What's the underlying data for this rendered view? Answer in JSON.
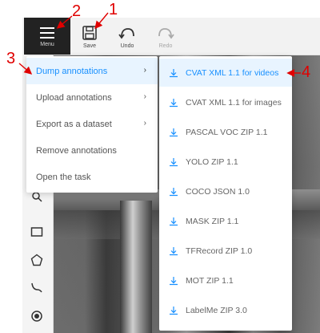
{
  "toolbar": {
    "menu_label": "Menu",
    "save_label": "Save",
    "undo_label": "Undo",
    "redo_label": "Redo"
  },
  "main_menu": {
    "items": [
      {
        "label": "Dump annotations",
        "has_submenu": true,
        "active": true
      },
      {
        "label": "Upload annotations",
        "has_submenu": true
      },
      {
        "label": "Export as a dataset",
        "has_submenu": true
      },
      {
        "label": "Remove annotations",
        "has_submenu": false
      },
      {
        "label": "Open the task",
        "has_submenu": false
      }
    ],
    "submenu_arrow": "›"
  },
  "dump_submenu": {
    "items": [
      {
        "label": "CVAT XML 1.1 for videos",
        "active": true
      },
      {
        "label": "CVAT XML 1.1 for images"
      },
      {
        "label": "PASCAL VOC ZIP 1.1"
      },
      {
        "label": "YOLO ZIP 1.1"
      },
      {
        "label": "COCO JSON 1.0"
      },
      {
        "label": "MASK ZIP 1.1"
      },
      {
        "label": "TFRecord ZIP 1.0"
      },
      {
        "label": "MOT ZIP 1.1"
      },
      {
        "label": "LabelMe ZIP 3.0"
      }
    ],
    "icon": "download-icon"
  },
  "annotations": {
    "n1": "1",
    "n2": "2",
    "n3": "3",
    "n4": "4"
  },
  "colors": {
    "accent": "#1890ff",
    "annotation": "#e00000",
    "menu_button_bg": "#222222"
  },
  "sidebar_icons": [
    "search-icon",
    "rectangle-icon",
    "polygon-icon",
    "polyline-icon",
    "point-icon"
  ]
}
